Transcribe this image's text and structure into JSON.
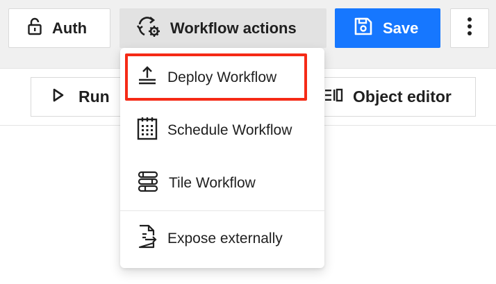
{
  "toolbar": {
    "auth_label": "Auth",
    "workflow_actions_label": "Workflow actions",
    "save_label": "Save",
    "run_label": "Run",
    "object_editor_label": "Object editor"
  },
  "dropdown": {
    "items": [
      {
        "label": "Deploy Workflow",
        "icon": "upload-icon",
        "highlighted": true
      },
      {
        "label": "Schedule Workflow",
        "icon": "calendar-icon"
      },
      {
        "label": "Tile Workflow",
        "icon": "tile-icon"
      },
      {
        "label": "Expose externally",
        "icon": "file-export-icon"
      }
    ]
  },
  "colors": {
    "primary": "#1677ff",
    "highlight": "#f52a16",
    "active_button_bg": "#e2e2e2"
  }
}
